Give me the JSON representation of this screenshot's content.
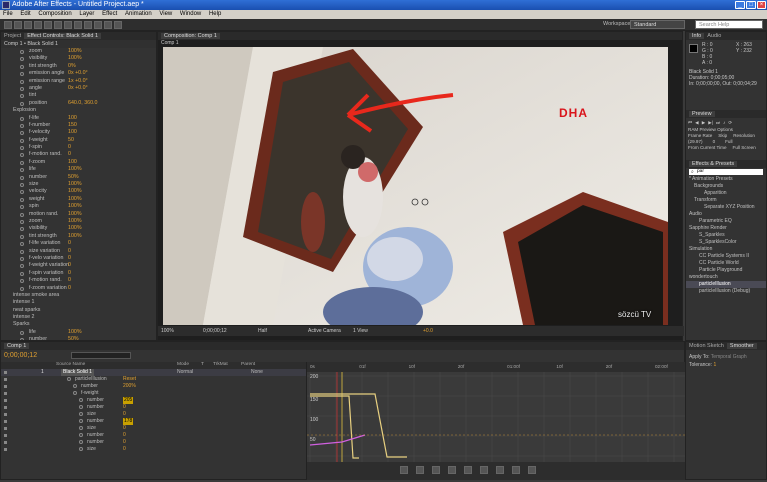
{
  "window": {
    "title": "Adobe After Effects - Untitled Project.aep *"
  },
  "menu": [
    "File",
    "Edit",
    "Composition",
    "Layer",
    "Effect",
    "Animation",
    "View",
    "Window",
    "Help"
  ],
  "workspace": {
    "label": "Workspace:",
    "value": "Standard",
    "search_placeholder": "Search Help"
  },
  "effect_controls": {
    "tabs": [
      "Project",
      "Effect Controls: Black Solid 1"
    ],
    "header": "Comp 1 • Black Solid 1",
    "rows": [
      {
        "label": "zoom",
        "value": "100%"
      },
      {
        "label": "visibility",
        "value": "100%"
      },
      {
        "label": "tint strength",
        "value": "0%"
      },
      {
        "label": "emission angle",
        "value": "0x +0.0°"
      },
      {
        "label": "emission range",
        "value": "1x +0.0°"
      },
      {
        "label": "angle",
        "value": "0x +0.0°"
      },
      {
        "label": "tint",
        "value": ""
      },
      {
        "label": "position",
        "value": "640.0, 360.0"
      },
      {
        "label": "Explosion",
        "value": ""
      },
      {
        "label": "f-life",
        "value": "100"
      },
      {
        "label": "f-number",
        "value": "150"
      },
      {
        "label": "f-velocity",
        "value": "100"
      },
      {
        "label": "f-weight",
        "value": "50"
      },
      {
        "label": "f-spin",
        "value": "0"
      },
      {
        "label": "f-motion rand.",
        "value": "0"
      },
      {
        "label": "f-zoom",
        "value": "100"
      },
      {
        "label": "life",
        "value": "100%"
      },
      {
        "label": "number",
        "value": "50%"
      },
      {
        "label": "size",
        "value": "100%"
      },
      {
        "label": "velocity",
        "value": "100%"
      },
      {
        "label": "weight",
        "value": "100%"
      },
      {
        "label": "spin",
        "value": "100%"
      },
      {
        "label": "motion rand.",
        "value": "100%"
      },
      {
        "label": "zoom",
        "value": "100%"
      },
      {
        "label": "visibility",
        "value": "100%"
      },
      {
        "label": "tint strength",
        "value": "100%"
      },
      {
        "label": "f-life variation",
        "value": "0"
      },
      {
        "label": "size variation",
        "value": "0"
      },
      {
        "label": "f-velo variation",
        "value": "0"
      },
      {
        "label": "f-weight variation",
        "value": "0"
      },
      {
        "label": "f-spin variation",
        "value": "0"
      },
      {
        "label": "f-motion rand.",
        "value": "0"
      },
      {
        "label": "f-zoom variation",
        "value": "0"
      },
      {
        "label": "intense smoke area",
        "value": ""
      },
      {
        "label": "intense 1",
        "value": ""
      },
      {
        "label": "neat sparks",
        "value": ""
      },
      {
        "label": "intense 2",
        "value": ""
      },
      {
        "label": "Sparks",
        "value": ""
      },
      {
        "label": "life",
        "value": "100%"
      },
      {
        "label": "number",
        "value": "50%"
      },
      {
        "label": "size",
        "value": "100%"
      },
      {
        "label": "velocity",
        "value": "100%"
      },
      {
        "label": "weight",
        "value": "100%"
      }
    ]
  },
  "composition": {
    "tab": "Composition: Comp 1",
    "subtab": "Comp 1",
    "watermark": "DHA",
    "channel": "sözcü TV",
    "bar": {
      "zoom": "100%",
      "timecode": "0;00;00;12",
      "resolution": "Half",
      "camera": "Active Camera",
      "views": "1 View",
      "offset": "+0.0"
    }
  },
  "info": {
    "tabs": [
      "Info",
      "Audio"
    ],
    "rgb": [
      "R : 0",
      "G : 0",
      "B : 0",
      "A : 0"
    ],
    "xy": [
      "X : 263",
      "Y : 232"
    ],
    "layer": "Black Solid 1",
    "duration": "Duration: 0;00;05;00",
    "inout": "In: 0;00;00;00, Out: 0;00;04;29"
  },
  "preview": {
    "tab": "Preview",
    "ram": "RAM Preview Options",
    "labels": [
      "Frame Rate",
      "Skip",
      "Resolution"
    ],
    "values": [
      "(29.97)",
      "0",
      "Full"
    ],
    "from_current": "From Current Time",
    "full_screen": "Full Screen"
  },
  "effects_presets": {
    "tab": "Effects & Presets",
    "search": "par",
    "items": [
      {
        "t": "* Animation Presets",
        "lvl": 0
      },
      {
        "t": "Backgrounds",
        "lvl": 1
      },
      {
        "t": "Apparition",
        "lvl": 3
      },
      {
        "t": "Transform",
        "lvl": 1
      },
      {
        "t": "Separate XYZ Position",
        "lvl": 3
      },
      {
        "t": "Audio",
        "lvl": 0
      },
      {
        "t": "Parametric EQ",
        "lvl": 2
      },
      {
        "t": "Sapphire Render",
        "lvl": 0
      },
      {
        "t": "S_Sparkles",
        "lvl": 2
      },
      {
        "t": "S_SparklesColor",
        "lvl": 2
      },
      {
        "t": "Simulation",
        "lvl": 0
      },
      {
        "t": "CC Particle Systems II",
        "lvl": 2
      },
      {
        "t": "CC Particle World",
        "lvl": 2
      },
      {
        "t": "Particle Playground",
        "lvl": 2
      },
      {
        "t": "wondertouch",
        "lvl": 0
      },
      {
        "t": "particleIllusion",
        "lvl": 2,
        "sel": true
      },
      {
        "t": "particleIllusion (Debug)",
        "lvl": 2
      }
    ]
  },
  "timeline": {
    "tab": "Comp 1",
    "timecode": "0;00;00;12",
    "columns": [
      "Source Name",
      "Mode",
      "T",
      "TrkMat",
      "Parent"
    ],
    "layer": {
      "num": "1",
      "name": "Black Solid 1",
      "mode": "Normal",
      "parent": "None"
    },
    "rows": [
      {
        "name": "particleIllusion",
        "value": "Reset",
        "indent": 1
      },
      {
        "name": "number",
        "value": "200%",
        "indent": 2
      },
      {
        "name": "f-weight",
        "value": "",
        "indent": 2
      },
      {
        "name": "number",
        "value": "205",
        "indent": 3,
        "sel": true
      },
      {
        "name": "number",
        "value": "0",
        "indent": 3
      },
      {
        "name": "size",
        "value": "0",
        "indent": 3
      },
      {
        "name": "number",
        "value": "178",
        "indent": 3,
        "sel": true
      },
      {
        "name": "size",
        "value": "0",
        "indent": 3
      },
      {
        "name": "number",
        "value": "0",
        "indent": 3
      },
      {
        "name": "number",
        "value": "0",
        "indent": 3
      },
      {
        "name": "size",
        "value": "0",
        "indent": 3
      }
    ],
    "ruler": [
      "0s",
      "01f",
      "10f",
      "20f",
      "01:00f",
      "10f",
      "20f",
      "02:00f"
    ],
    "graph_labels": [
      "200",
      "150",
      "100",
      "50"
    ]
  },
  "motion": {
    "tabs": [
      "Motion Sketch",
      "Smoother"
    ],
    "apply_label": "Apply To:",
    "apply_value": "Temporal Graph",
    "tolerance_label": "Tolerance:",
    "tolerance_value": "1"
  }
}
